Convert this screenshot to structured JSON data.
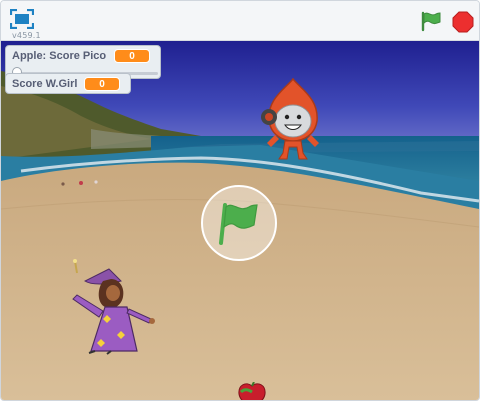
{
  "header": {
    "version": "v459.1",
    "fullscreen_icon": "fullscreen-icon",
    "green_flag_icon": "green-flag-icon",
    "stop_icon": "stop-sign-icon"
  },
  "monitors": [
    {
      "label": "Apple: Score Pico",
      "value": "0",
      "slider": 0
    },
    {
      "label": "Score W.Girl",
      "value": "0"
    }
  ],
  "stage": {
    "backdrop": "beach",
    "sprites": [
      "pico-sprite",
      "wizard-girl-sprite",
      "apple-sprite"
    ],
    "start_overlay_icon": "green-flag-icon"
  },
  "colors": {
    "flag_green": "#4cae4c",
    "stop_red": "#ec2f2f",
    "monitor_value": "#ff8c1a",
    "fullscreen_blue": "#1e82c3"
  }
}
